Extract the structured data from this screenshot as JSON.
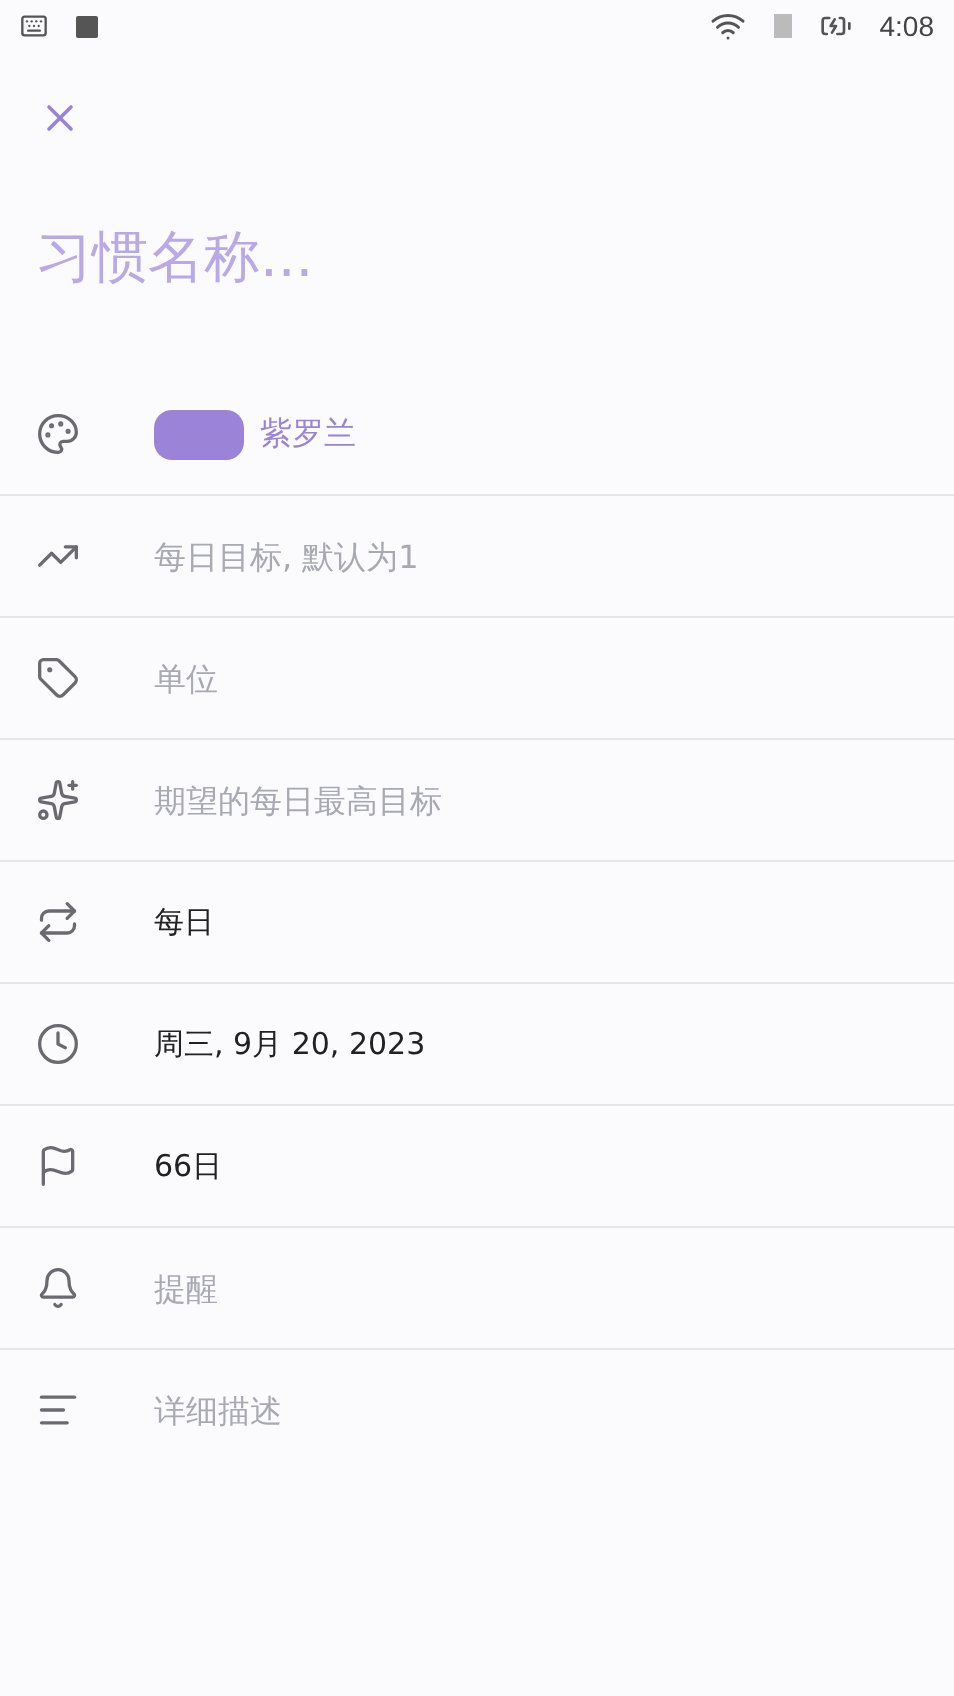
{
  "status_bar": {
    "time": "4:08"
  },
  "name_field": {
    "placeholder": "习惯名称..."
  },
  "rows": [
    {
      "kind": "color",
      "label": "紫罗兰",
      "color": "#9b84d8"
    },
    {
      "kind": "field",
      "placeholder": "每日目标, 默认为1"
    },
    {
      "kind": "field",
      "placeholder": "单位"
    },
    {
      "kind": "field",
      "placeholder": "期望的每日最高目标"
    },
    {
      "kind": "value",
      "value": "每日"
    },
    {
      "kind": "value",
      "value": "周三, 9月 20, 2023"
    },
    {
      "kind": "value",
      "value": "66日"
    },
    {
      "kind": "field",
      "placeholder": "提醒"
    },
    {
      "kind": "field",
      "placeholder": "详细描述"
    }
  ]
}
